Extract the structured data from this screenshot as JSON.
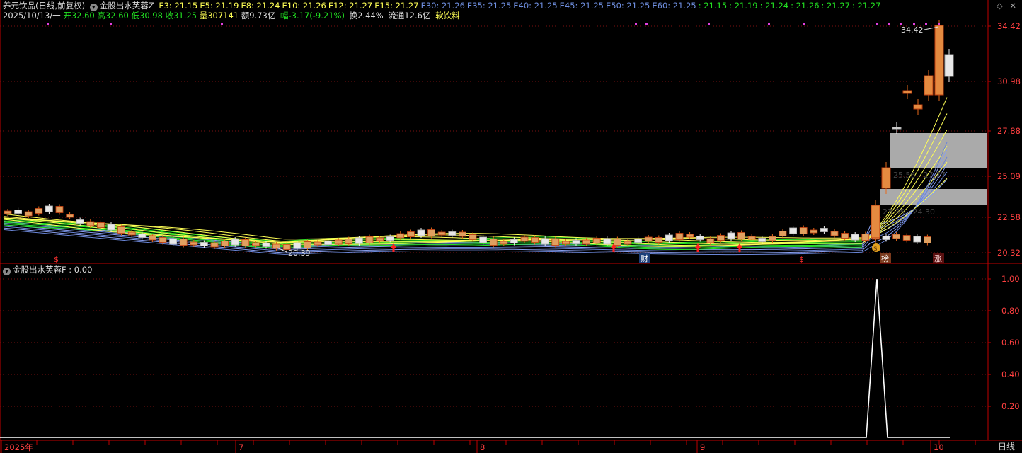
{
  "header": {
    "stock": "养元饮品(日线,前复权)",
    "indicator_name": "金股出水芙蓉Z",
    "ema_values": [
      {
        "label": "E3: 21.15",
        "color": "#ffff55"
      },
      {
        "label": "E5: 21.19",
        "color": "#ffff55"
      },
      {
        "label": "E8: 21.24",
        "color": "#ffff55"
      },
      {
        "label": "E10: 21.26",
        "color": "#ffff55"
      },
      {
        "label": "E12: 21.27",
        "color": "#ffff55"
      },
      {
        "label": "E15: 21.27",
        "color": "#ffff55"
      },
      {
        "label": "E30: 21.26",
        "color": "#6f8fe0"
      },
      {
        "label": "E35: 21.25",
        "color": "#6f8fe0"
      },
      {
        "label": "E40: 21.25",
        "color": "#6f8fe0"
      },
      {
        "label": "E45: 21.25",
        "color": "#6f8fe0"
      },
      {
        "label": "E50: 21.25",
        "color": "#6f8fe0"
      },
      {
        "label": "E60: 21.25",
        "color": "#6f8fe0"
      },
      {
        "label": ": 21.15",
        "color": "#22e022"
      },
      {
        "label": ": 21.19",
        "color": "#22e022"
      },
      {
        "label": ": 21.24",
        "color": "#22e022"
      },
      {
        "label": ": 21.26",
        "color": "#22e022"
      },
      {
        "label": ": 21.27",
        "color": "#22e022"
      },
      {
        "label": ": 21.27",
        "color": "#22e022"
      }
    ]
  },
  "quote": {
    "date": "2025/10/13/一",
    "open": "开32.60",
    "high": "高32.60",
    "low": "低30.98",
    "close": "收31.25",
    "volume": "量307141",
    "amount": "额9.73亿",
    "change": "幅-3.17(-9.21%)",
    "turnover": "换2.44%",
    "float": "流通12.6亿",
    "sector": "软饮料"
  },
  "sub_header": "金股出水芙蓉F : 0.00",
  "main_axis_labels": [
    "34.42",
    "30.98",
    "27.88",
    "25.09",
    "22.58",
    "20.32"
  ],
  "sub_axis_labels": [
    "1.00",
    "0.80",
    "0.60",
    "0.40",
    "0.20"
  ],
  "time_axis_labels": [
    "2025年",
    "7",
    "8",
    "9",
    "10"
  ],
  "period_label": "日线",
  "annotations": {
    "high_price": "34.42",
    "low_price": "20.39",
    "zone_upper": "25.56 - 27.77",
    "zone_lower": "23.35 - 24.30",
    "markers": [
      "$",
      "财",
      "$",
      "$",
      "榜",
      "涨"
    ]
  },
  "controls": [
    "◇",
    "✕"
  ],
  "colors": {
    "up": "#ff3030",
    "down": "#ffffff",
    "border": "#c00000",
    "accent_yellow": "#ffff55"
  }
}
